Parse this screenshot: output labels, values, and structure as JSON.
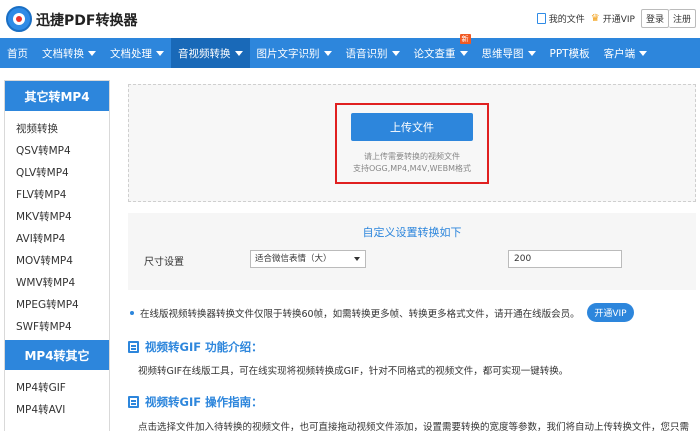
{
  "header": {
    "brand": "迅捷PDF转换器",
    "my_files": "我的文件",
    "open_vip": "开通VIP",
    "login": "登录",
    "register": "注册"
  },
  "nav": {
    "items": [
      {
        "label": "首页",
        "dropdown": false
      },
      {
        "label": "文档转换",
        "dropdown": true
      },
      {
        "label": "文档处理",
        "dropdown": true
      },
      {
        "label": "音视频转换",
        "dropdown": true,
        "active": true
      },
      {
        "label": "图片文字识别",
        "dropdown": true
      },
      {
        "label": "语音识别",
        "dropdown": true
      },
      {
        "label": "论文查重",
        "dropdown": true,
        "badge": "新"
      },
      {
        "label": "思维导图",
        "dropdown": true
      },
      {
        "label": "PPT模板",
        "dropdown": false
      },
      {
        "label": "客户端",
        "dropdown": true
      }
    ]
  },
  "sidebar": {
    "section1_title": "其它转MP4",
    "section1_items": [
      "视频转换",
      "QSV转MP4",
      "QLV转MP4",
      "FLV转MP4",
      "MKV转MP4",
      "AVI转MP4",
      "MOV转MP4",
      "WMV转MP4",
      "MPEG转MP4",
      "SWF转MP4"
    ],
    "section2_title": "MP4转其它",
    "section2_items": [
      "MP4转GIF",
      "MP4转AVI"
    ]
  },
  "upload": {
    "button": "上传文件",
    "hint_line1": "请上传需要转换的视频文件",
    "hint_line2": "支持OGG,MP4,M4V,WEBM格式"
  },
  "settings": {
    "title": "自定义设置转换如下",
    "size_label": "尺寸设置",
    "size_select": "适合微信表情（大）",
    "size_value": "200"
  },
  "notice": {
    "text": "在线版视频转换器转换文件仅限于转换60帧，如需转换更多帧、转换更多格式文件，请开通在线版会员。",
    "vip_button": "开通VIP"
  },
  "intro": {
    "title": "视频转GIF 功能介绍：",
    "text": "视频转GIF在线版工具，可在线实现将视频转换成GIF，针对不同格式的视频文件，都可实现一键转换。"
  },
  "guide": {
    "title": "视频转GIF 操作指南：",
    "text": "点击选择文件加入待转换的视频文件，也可直接拖动视频文件添加，设置需要转换的宽度等参数，我们将自动上传转换文件，您只需"
  },
  "colors": {
    "primary": "#2d86dc",
    "nav_active": "#1969b8",
    "highlight_frame": "#e02020",
    "badge": "#f15a24"
  }
}
